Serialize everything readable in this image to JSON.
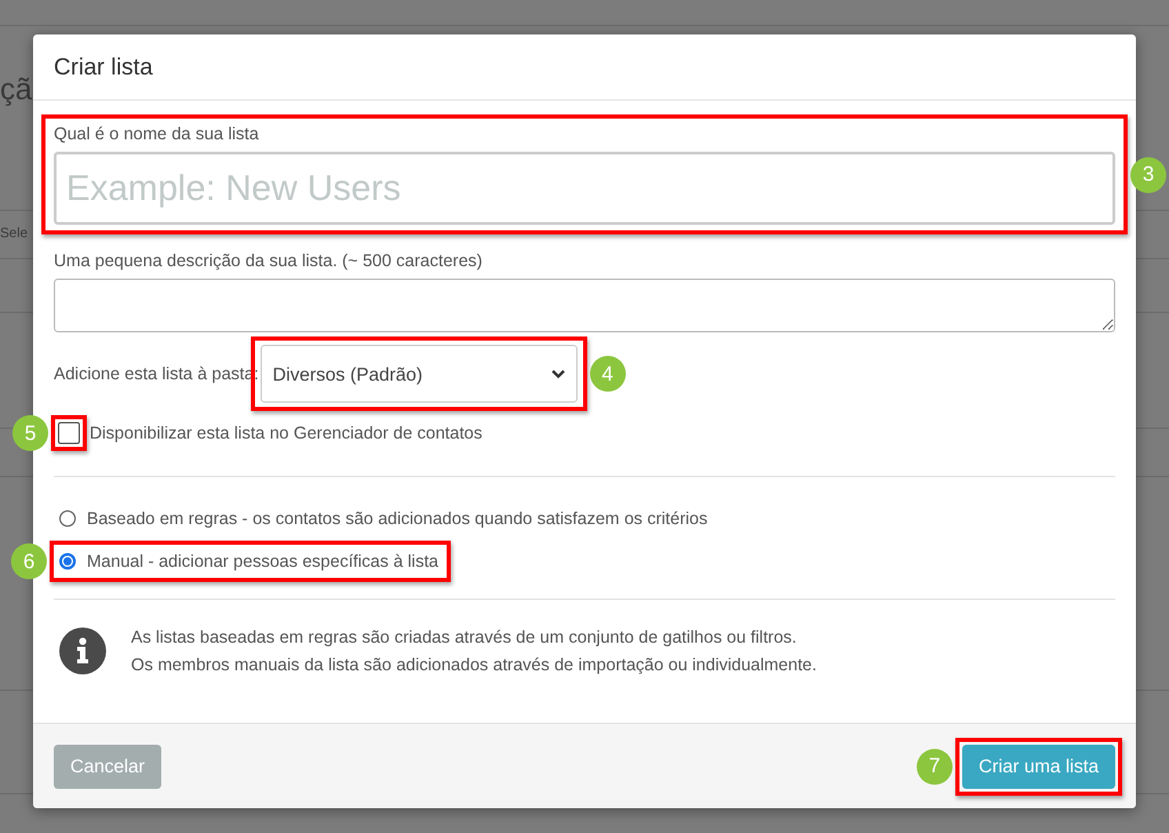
{
  "background": {
    "heading": "çã",
    "column_1": "Sele"
  },
  "dialog": {
    "title": "Criar lista",
    "name_field": {
      "label": "Qual é o nome da sua lista",
      "placeholder": "Example: New Users",
      "callout": "3"
    },
    "description_field": {
      "label": "Uma pequena descrição da sua lista. (~ 500 caracteres)"
    },
    "folder": {
      "label": "Adicione esta lista à pasta:",
      "value": "Diversos (Padrão)",
      "callout": "4"
    },
    "contact_manager": {
      "label": "Disponibilizar esta lista no Gerenciador de contatos",
      "checked": false,
      "callout": "5"
    },
    "list_types": [
      {
        "label": "Baseado em regras - os contatos são adicionados quando satisfazem os critérios",
        "selected": false
      },
      {
        "label": "Manual - adicionar pessoas específicas à lista",
        "selected": true,
        "callout": "6"
      }
    ],
    "info": [
      "As listas baseadas em regras são criadas através de um conjunto de gatilhos ou filtros.",
      "Os membros manuais da lista são adicionados através de importação ou individualmente."
    ],
    "buttons": [
      {
        "label": "Cancelar",
        "kind": "secondary"
      },
      {
        "label": "Criar uma lista",
        "kind": "primary",
        "callout": "7"
      }
    ]
  }
}
